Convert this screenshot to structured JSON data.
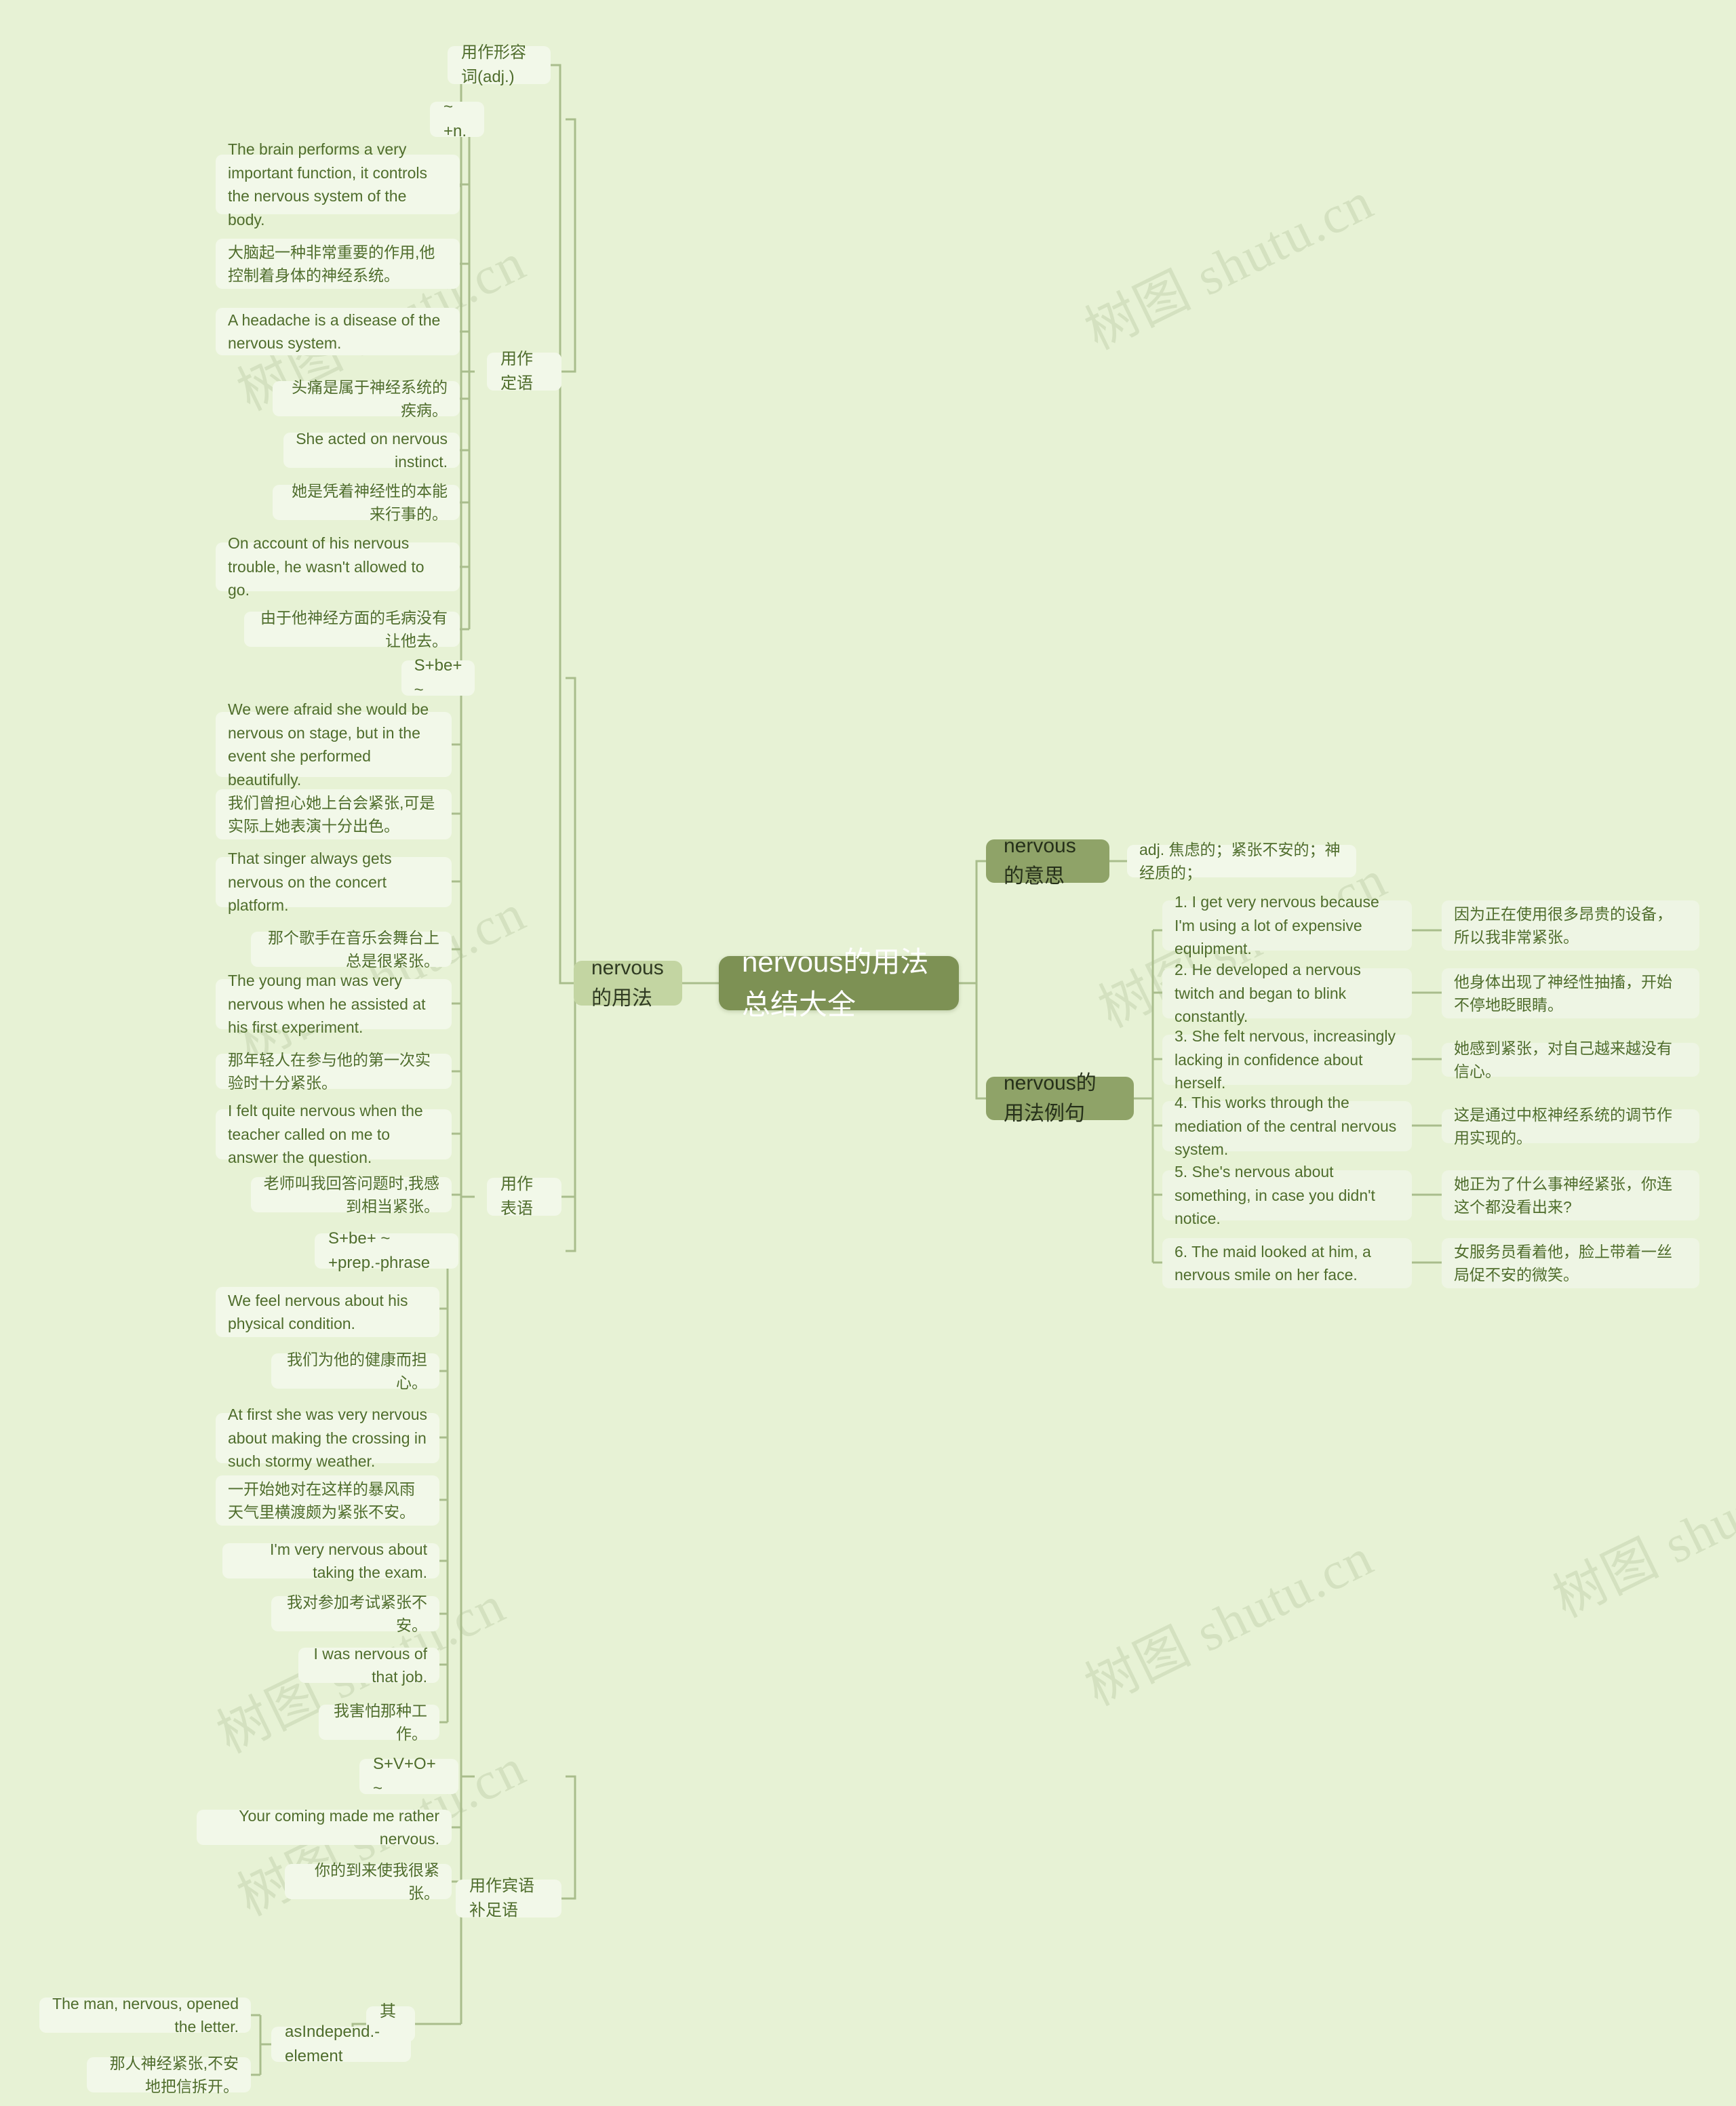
{
  "theme": {
    "background": "#e7f2d5",
    "leaf_bg": "#f2f8e9",
    "branch_bg": "#c3d5a2",
    "branch_dark_bg": "#8fa368",
    "root_bg": "#7d9154",
    "text": "#4f6d2c",
    "link": "#a9bd8c"
  },
  "watermark": {
    "text": "树图 shutu.cn"
  },
  "root": {
    "title": "nervous的用法总结大全"
  },
  "left_branch": {
    "label": "nervous的用法",
    "groups": [
      {
        "label": "用作形容词(adj.)",
        "subgroups": [
          {
            "label": "用作定语",
            "pattern": "~ +n.",
            "items": [
              {
                "en": "The brain performs a very important function, it controls the nervous system of the body."
              },
              {
                "cn": "大脑起一种非常重要的作用,他控制着身体的神经系统。"
              },
              {
                "en": "A headache is a disease of the nervous system."
              },
              {
                "cn": "头痛是属于神经系统的疾病。"
              },
              {
                "en": "She acted on nervous instinct."
              },
              {
                "cn": "她是凭着神经性的本能来行事的。"
              },
              {
                "en": "On account of his nervous trouble, he wasn't allowed to go."
              },
              {
                "cn": "由于他神经方面的毛病没有让他去。"
              }
            ]
          },
          {
            "label": "用作表语",
            "patterns": [
              "S+be+ ~",
              "S+be+ ~ +prep.-phrase"
            ],
            "items_a": [
              {
                "en": "We were afraid she would be nervous on stage, but in the event she performed beautifully."
              },
              {
                "cn": "我们曾担心她上台会紧张,可是实际上她表演十分出色。"
              },
              {
                "en": "That singer always gets nervous on the concert platform."
              },
              {
                "cn": "那个歌手在音乐会舞台上总是很紧张。"
              },
              {
                "en": "The young man was very nervous when he assisted at his first experiment."
              },
              {
                "cn": "那年轻人在参与他的第一次实验时十分紧张。"
              },
              {
                "en": "I felt quite nervous when the teacher called on me to answer the question."
              },
              {
                "cn": "老师叫我回答问题时,我感到相当紧张。"
              }
            ],
            "items_b": [
              {
                "en": "We feel nervous about his physical condition."
              },
              {
                "cn": "我们为他的健康而担心。"
              },
              {
                "en": "At first she was very nervous about making the crossing in such stormy weather."
              },
              {
                "cn": "一开始她对在这样的暴风雨天气里横渡颇为紧张不安。"
              },
              {
                "en": "I'm very nervous about taking the exam."
              },
              {
                "cn": "我对参加考试紧张不安。"
              },
              {
                "en": "I was nervous of that job."
              },
              {
                "cn": "我害怕那种工作。"
              }
            ]
          },
          {
            "label": "用作宾语补足语",
            "pattern": "S+V+O+ ~",
            "items": [
              {
                "en": "Your coming made me rather nervous."
              },
              {
                "cn": "你的到来使我很紧张。"
              }
            ]
          },
          {
            "label": "其他",
            "pattern": "asIndepend.-element",
            "items": [
              {
                "en": "The man, nervous, opened the letter."
              },
              {
                "cn": "那人神经紧张,不安地把信拆开。"
              }
            ]
          }
        ]
      }
    ]
  },
  "right_branch": {
    "meaning": {
      "label": "nervous的意思",
      "definition": "adj. 焦虑的；紧张不安的；神经质的；"
    },
    "examples": {
      "label": "nervous的用法例句",
      "items": [
        {
          "en": "1. I get very nervous because I'm using a lot of expensive equipment.",
          "cn": "因为正在使用很多昂贵的设备，所以我非常紧张。"
        },
        {
          "en": "2. He developed a nervous twitch and began to blink constantly.",
          "cn": "他身体出现了神经性抽搐，开始不停地眨眼睛。"
        },
        {
          "en": "3. She felt nervous, increasingly lacking in confidence about herself.",
          "cn": "她感到紧张，对自己越来越没有信心。"
        },
        {
          "en": "4. This works through the mediation of the central nervous system.",
          "cn": "这是通过中枢神经系统的调节作用实现的。"
        },
        {
          "en": "5. She's nervous about something, in case you didn't notice.",
          "cn": "她正为了什么事神经紧张，你连这个都没看出来?"
        },
        {
          "en": "6. The maid looked at him, a nervous smile on her face.",
          "cn": "女服务员看着他，脸上带着一丝局促不安的微笑。"
        }
      ]
    }
  }
}
